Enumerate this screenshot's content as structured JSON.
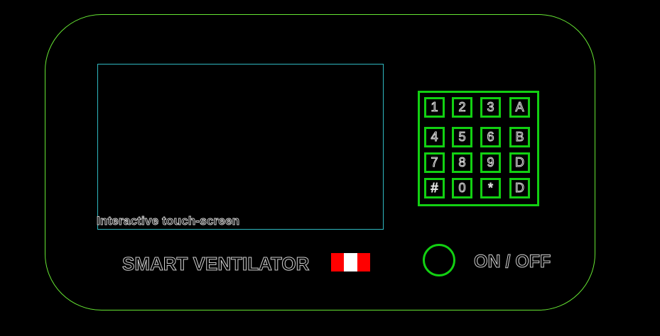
{
  "screen": {
    "label": "Interactive touch-screen"
  },
  "keypad": {
    "rows": [
      [
        "1",
        "2",
        "3",
        "A"
      ],
      [
        "4",
        "5",
        "6",
        "B"
      ],
      [
        "7",
        "8",
        "9",
        "D"
      ],
      [
        "#",
        "0",
        "*",
        "D"
      ]
    ]
  },
  "device": {
    "title": "SMART VENTILATOR",
    "flag_colors": [
      "#ff0000",
      "#ffffff",
      "#ff0000"
    ]
  },
  "power": {
    "label": "ON / OFF"
  },
  "colors": {
    "outline": "#66e633",
    "keypad": "#12d012",
    "screen_border": "#2fb8c0"
  }
}
